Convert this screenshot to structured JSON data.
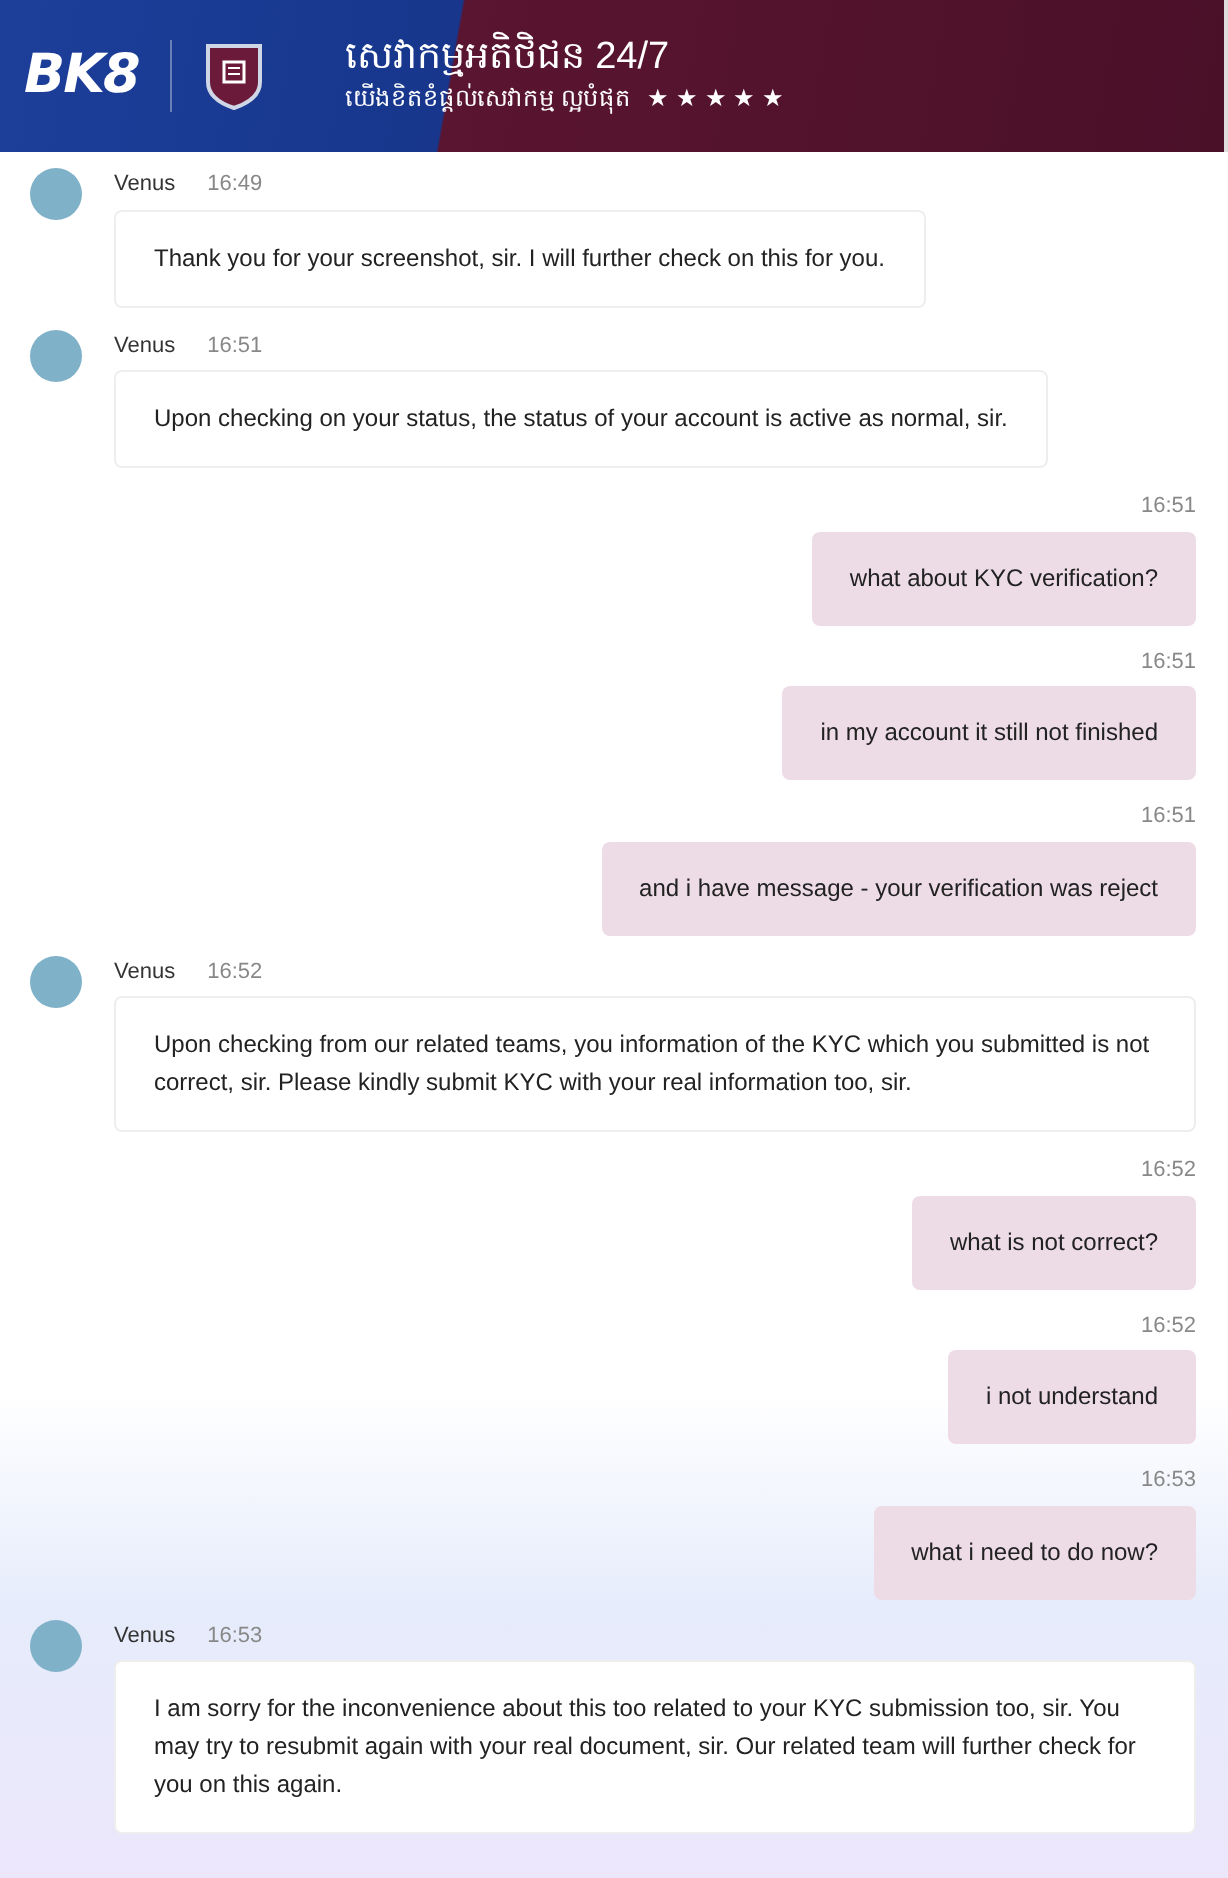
{
  "header": {
    "logo": "BK8",
    "title": "សេវាកម្មអតិថិជន 24/7",
    "subtitle": "យើងខិតខំផ្តល់សេវាកម្ម ល្អបំផុត",
    "stars": "★ ★ ★ ★ ★"
  },
  "messages": [
    {
      "kind": "agent",
      "name": "Venus",
      "time": "16:49",
      "text": "Thank you for your screenshot, sir. I will further check on this for you."
    },
    {
      "kind": "agent",
      "name": "Venus",
      "time": "16:51",
      "text": "Upon checking on your status, the status of your account is active as normal, sir."
    },
    {
      "kind": "user",
      "time": "16:51",
      "text": "what about KYC verification?"
    },
    {
      "kind": "user",
      "time": "16:51",
      "text": "in my account it still not finished"
    },
    {
      "kind": "user",
      "time": "16:51",
      "text": "and i have message - your verification was reject"
    },
    {
      "kind": "agent",
      "name": "Venus",
      "time": "16:52",
      "text": "Upon checking from our related teams, you information of the KYC which you submitted is not correct, sir. Please kindly submit KYC with your real information too, sir."
    },
    {
      "kind": "user",
      "time": "16:52",
      "text": "what is not correct?"
    },
    {
      "kind": "user",
      "time": "16:52",
      "text": "i not understand"
    },
    {
      "kind": "user",
      "time": "16:53",
      "text": "what i need to do now?"
    },
    {
      "kind": "agent",
      "name": "Venus",
      "time": "16:53",
      "text": "I am sorry for the inconvenience about this too related to your KYC submission too, sir. You may try to resubmit again with your real document, sir. Our related team will further check for you on this again."
    }
  ]
}
